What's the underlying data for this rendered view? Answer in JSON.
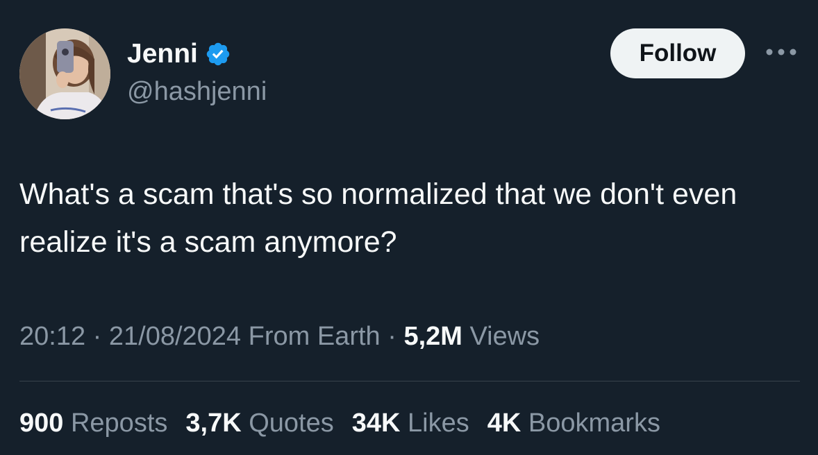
{
  "user": {
    "display_name": "Jenni",
    "handle": "@hashjenni",
    "verified": true,
    "avatar_icon": "profile-photo"
  },
  "actions": {
    "follow_label": "Follow",
    "more_icon": "more-horizontal-icon"
  },
  "tweet": {
    "text": "What's a scam that's so normalized that we don't even realize it's a scam anymore?",
    "time": "20:12",
    "date": "21/08/2024",
    "source": "From Earth",
    "views_count": "5,2M",
    "views_label": "Views"
  },
  "stats": [
    {
      "count": "900",
      "label": "Reposts"
    },
    {
      "count": "3,7K",
      "label": "Quotes"
    },
    {
      "count": "34K",
      "label": "Likes"
    },
    {
      "count": "4K",
      "label": "Bookmarks"
    }
  ],
  "colors": {
    "background": "#15202b",
    "text_primary": "#f7f9f9",
    "text_secondary": "#8b98a5",
    "verified_blue": "#1d9bf0",
    "follow_bg": "#eff3f4",
    "divider": "#38444d"
  }
}
